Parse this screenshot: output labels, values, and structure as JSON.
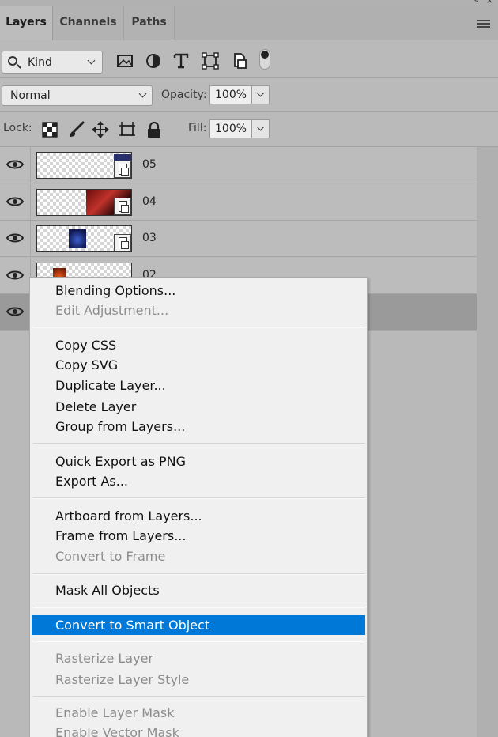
{
  "panel": {
    "tabs": [
      {
        "label": "Layers",
        "active": true
      },
      {
        "label": "Channels",
        "active": false
      },
      {
        "label": "Paths",
        "active": false
      }
    ]
  },
  "filter": {
    "kind_label": "Kind",
    "icons": [
      "image-filter-icon",
      "adjustment-filter-icon",
      "type-filter-icon",
      "shape-filter-icon",
      "smart-object-filter-icon",
      "filter-toggle-icon"
    ]
  },
  "blend": {
    "mode": "Normal",
    "opacity_label": "Opacity:",
    "opacity_value": "100%"
  },
  "lock": {
    "label": "Lock:",
    "fill_label": "Fill:",
    "fill_value": "100%"
  },
  "layers": [
    {
      "name": "05",
      "visible": true,
      "selected": false
    },
    {
      "name": "04",
      "visible": true,
      "selected": false
    },
    {
      "name": "03",
      "visible": true,
      "selected": false
    },
    {
      "name": "02",
      "visible": true,
      "selected": false
    },
    {
      "name": "",
      "visible": true,
      "selected": true
    }
  ],
  "context_menu": {
    "groups": [
      [
        {
          "label": "Blending Options...",
          "enabled": true
        },
        {
          "label": "Edit Adjustment...",
          "enabled": false
        }
      ],
      [
        {
          "label": "Copy CSS",
          "enabled": true
        },
        {
          "label": "Copy SVG",
          "enabled": true
        },
        {
          "label": "Duplicate Layer...",
          "enabled": true
        },
        {
          "label": "Delete Layer",
          "enabled": true
        },
        {
          "label": "Group from Layers...",
          "enabled": true
        }
      ],
      [
        {
          "label": "Quick Export as PNG",
          "enabled": true
        },
        {
          "label": "Export As...",
          "enabled": true
        }
      ],
      [
        {
          "label": "Artboard from Layers...",
          "enabled": true
        },
        {
          "label": "Frame from Layers...",
          "enabled": true
        },
        {
          "label": "Convert to Frame",
          "enabled": false
        }
      ],
      [
        {
          "label": "Mask All Objects",
          "enabled": true
        }
      ],
      [
        {
          "label": "Convert to Smart Object",
          "enabled": true,
          "highlighted": true
        }
      ],
      [
        {
          "label": "Rasterize Layer",
          "enabled": false
        },
        {
          "label": "Rasterize Layer Style",
          "enabled": false
        }
      ],
      [
        {
          "label": "Enable Layer Mask",
          "enabled": false
        },
        {
          "label": "Enable Vector Mask",
          "enabled": false
        }
      ]
    ]
  },
  "colors": {
    "highlight": "#0078d7",
    "panel_bg": "#bababa",
    "menu_bg": "#f0f0f0",
    "disabled_text": "#8c8c8c"
  }
}
